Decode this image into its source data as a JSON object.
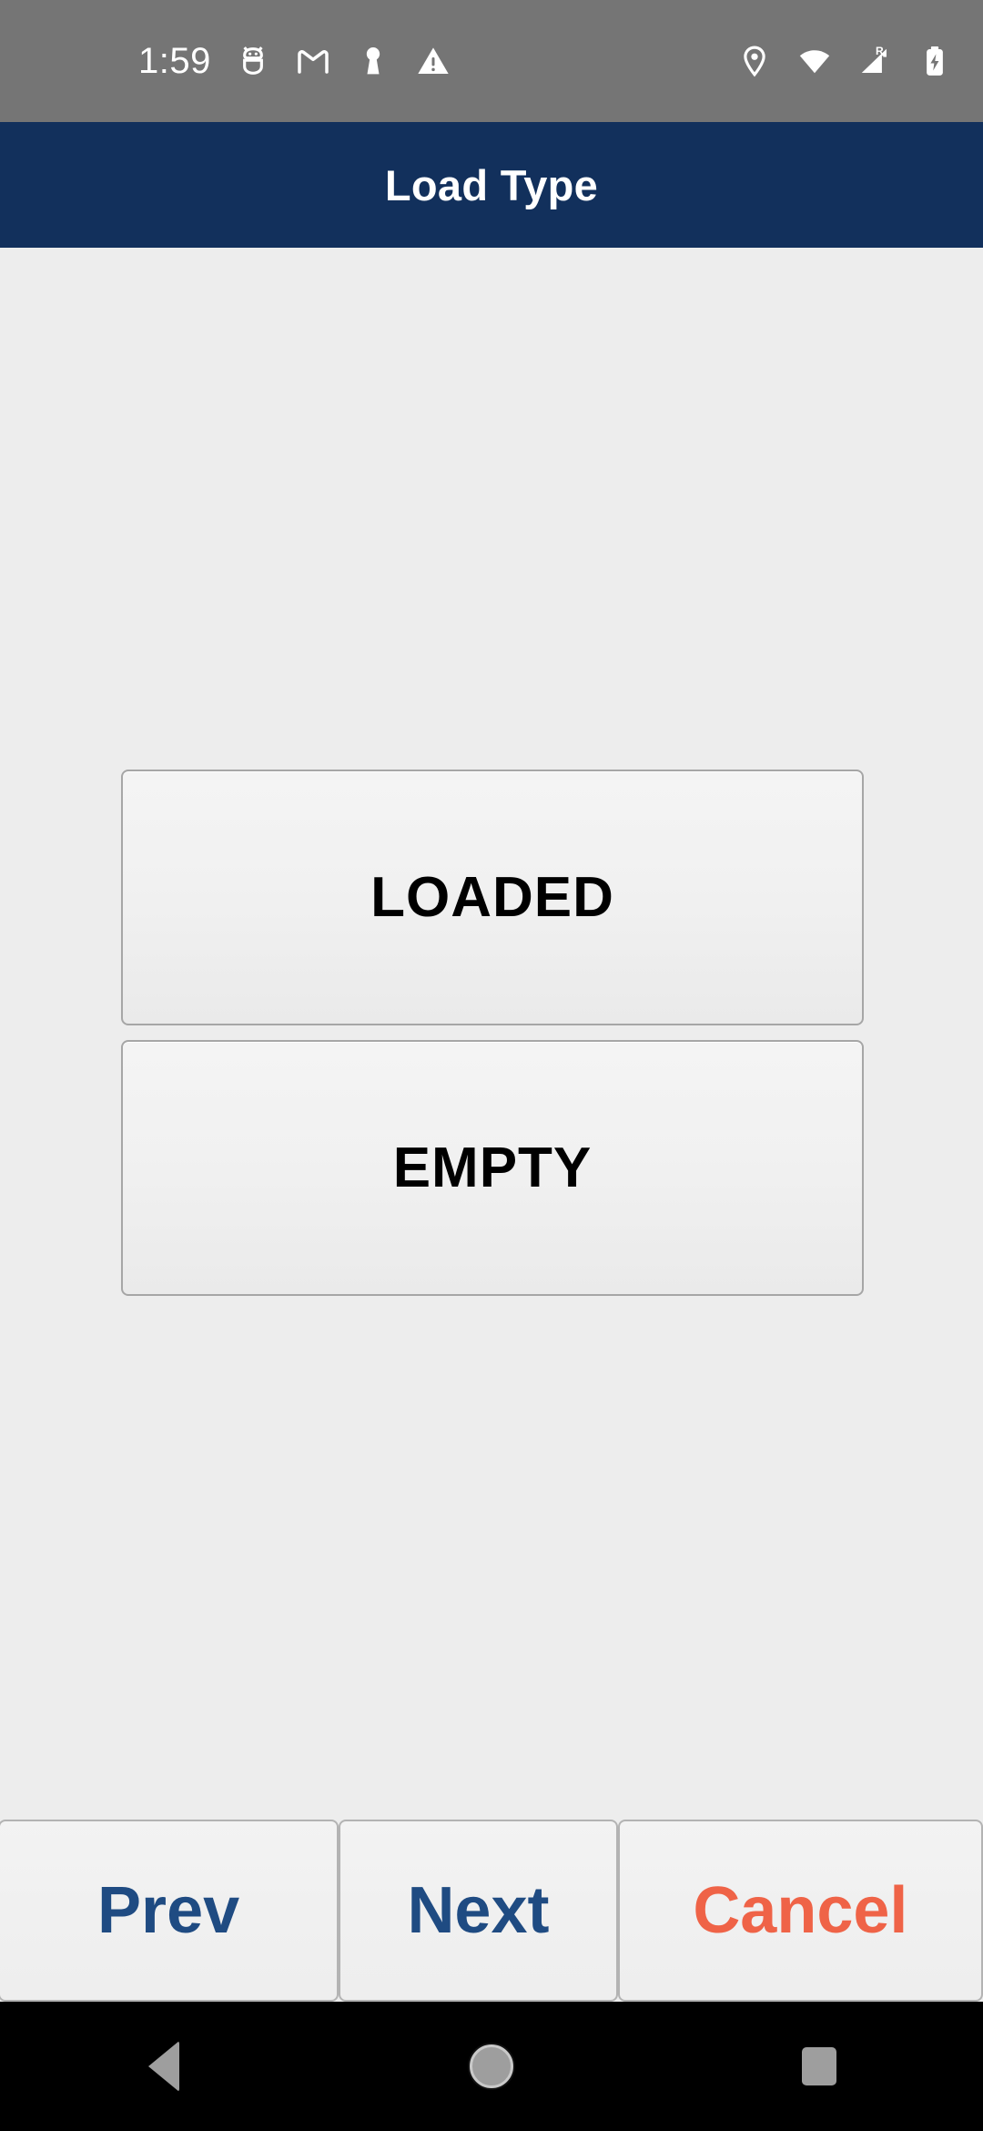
{
  "status_bar": {
    "time": "1:59",
    "left_icons": [
      "android-head-icon",
      "gmail-icon",
      "keyhole-icon",
      "warning-triangle-icon"
    ],
    "right_icons": [
      "location-pin-icon",
      "wifi-icon",
      "cellular-roaming-icon",
      "battery-charging-icon"
    ],
    "roaming_label": "R",
    "background_color": "#757575",
    "foreground_color": "#ffffff"
  },
  "title_bar": {
    "title": "Load Type",
    "background_color": "#12305c",
    "text_color": "#ffffff"
  },
  "main": {
    "background_color": "#ededed",
    "options": [
      {
        "label": "LOADED"
      },
      {
        "label": "EMPTY"
      }
    ]
  },
  "action_bar": {
    "buttons": [
      {
        "label": "Prev",
        "color": "#1f4b82"
      },
      {
        "label": "Next",
        "color": "#1f4b82"
      },
      {
        "label": "Cancel",
        "color": "#ef6347"
      }
    ]
  },
  "navigation_bar": {
    "background_color": "#000000",
    "buttons": [
      "back-icon",
      "home-icon",
      "recents-icon"
    ]
  }
}
